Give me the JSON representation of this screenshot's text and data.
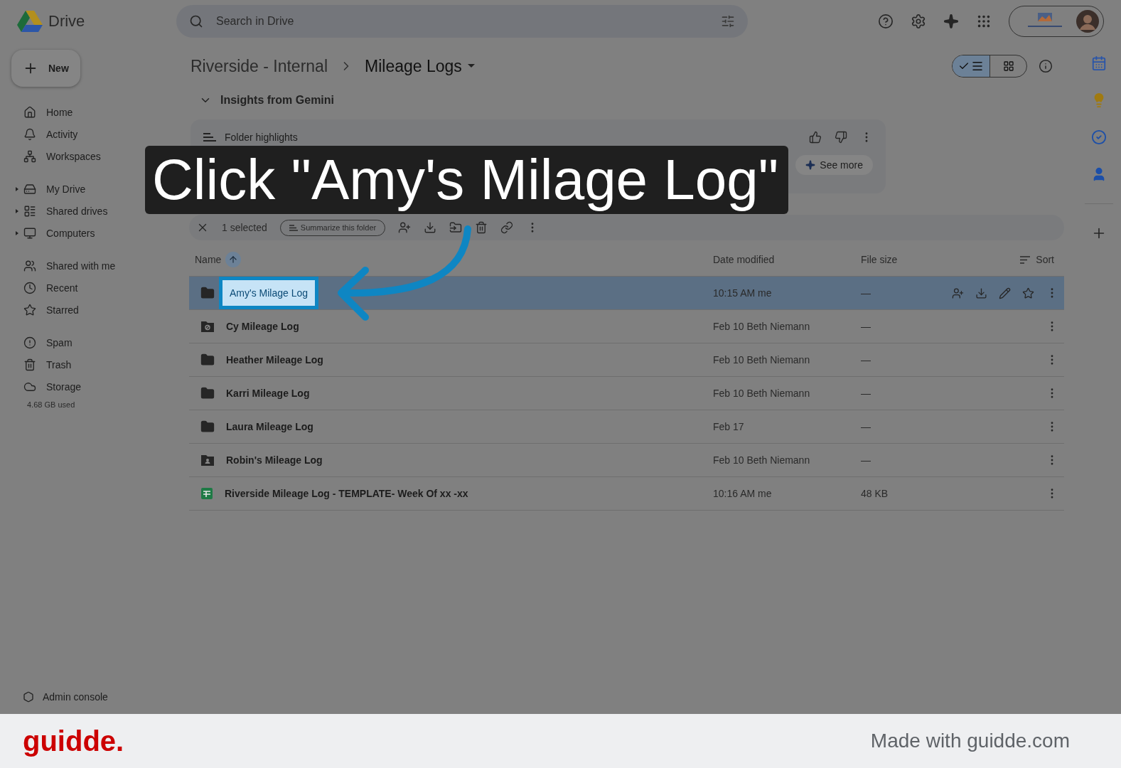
{
  "app": {
    "name": "Drive"
  },
  "search": {
    "placeholder": "Search in Drive"
  },
  "new_button": {
    "label": "New"
  },
  "sidebar": {
    "groups": [
      [
        {
          "label": "Home",
          "expandable": false
        },
        {
          "label": "Activity",
          "expandable": false
        },
        {
          "label": "Workspaces",
          "expandable": false
        }
      ],
      [
        {
          "label": "My Drive",
          "expandable": true
        },
        {
          "label": "Shared drives",
          "expandable": true
        },
        {
          "label": "Computers",
          "expandable": true
        }
      ],
      [
        {
          "label": "Shared with me",
          "expandable": false
        },
        {
          "label": "Recent",
          "expandable": false
        },
        {
          "label": "Starred",
          "expandable": false
        }
      ],
      [
        {
          "label": "Spam",
          "expandable": false
        },
        {
          "label": "Trash",
          "expandable": false
        },
        {
          "label": "Storage",
          "expandable": false
        }
      ]
    ],
    "storage_used": "4.68 GB used",
    "admin": "Admin console"
  },
  "breadcrumb": [
    {
      "label": "Riverside - Internal"
    },
    {
      "label": "Mileage Logs"
    }
  ],
  "view_toggle": [
    {
      "selected": true
    },
    {
      "selected": false
    }
  ],
  "gemini": {
    "title": "Insights from Gemini",
    "expanded": true,
    "card_title": "Folder highlights",
    "see_more": "See more"
  },
  "selection_bar": {
    "count": "1 selected",
    "summarize": "Summarize this folder"
  },
  "columns": [
    "Name",
    "Date modified",
    "File size"
  ],
  "sort_label": "Sort",
  "rows": [
    {
      "kind": "folder",
      "name": "Amy's Milage Log",
      "modified": "10:15 AM me",
      "size": "—",
      "selected": true,
      "highlighted": true
    },
    {
      "kind": "blocked-folder",
      "name": "Cy Mileage Log",
      "modified": "Feb 10 Beth Niemann",
      "size": "—",
      "selected": false,
      "highlighted": false
    },
    {
      "kind": "folder",
      "name": "Heather Mileage Log",
      "modified": "Feb 10 Beth Niemann",
      "size": "—",
      "selected": false,
      "highlighted": false
    },
    {
      "kind": "folder",
      "name": "Karri Mileage Log",
      "modified": "Feb 10 Beth Niemann",
      "size": "—",
      "selected": false,
      "highlighted": false
    },
    {
      "kind": "folder",
      "name": "Laura Mileage Log",
      "modified": "Feb 17",
      "size": "—",
      "selected": false,
      "highlighted": false
    },
    {
      "kind": "shared-folder",
      "name": "Robin's Mileage Log",
      "modified": "Feb 10 Beth Niemann",
      "size": "—",
      "selected": false,
      "highlighted": false
    },
    {
      "kind": "sheet",
      "name": "Riverside Mileage Log - TEMPLATE- Week Of xx -xx",
      "modified": "10:16 AM me",
      "size": "48 KB",
      "selected": false,
      "highlighted": false
    }
  ],
  "callout": {
    "text": "Click \"Amy's Milage Log\""
  },
  "footer": {
    "brand": "guidde.",
    "credit": "Made with guidde.com"
  }
}
